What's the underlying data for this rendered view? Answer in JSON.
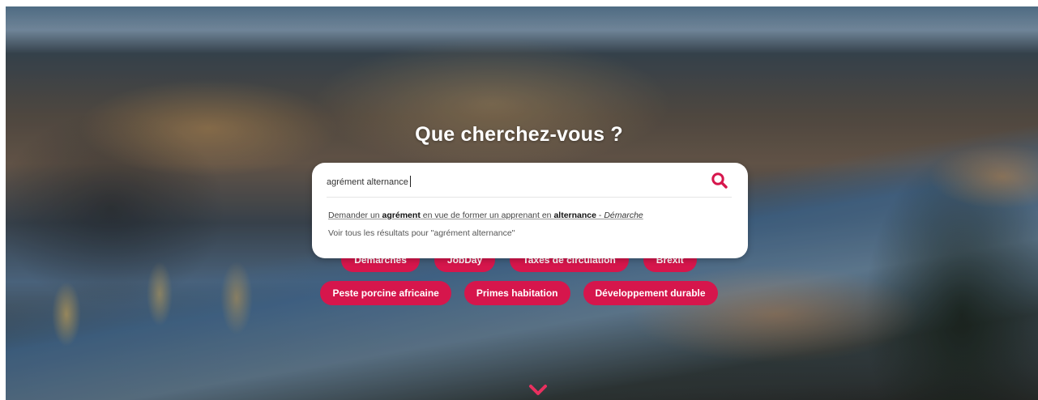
{
  "hero": {
    "title": "Que cherchez-vous ?"
  },
  "search": {
    "value": "agrément alternance",
    "suggestion": {
      "part1": "Demander un ",
      "bold1": "agrément",
      "part2": " en vue de former un apprenant en ",
      "bold2": "alternance",
      "part3": " - ",
      "type": "Démarche"
    },
    "see_all": "Voir tous les résultats pour \"agrément alternance\""
  },
  "tags_row1": [
    {
      "label": "Démarches"
    },
    {
      "label": "JobDay"
    },
    {
      "label": "Taxes de circulation"
    },
    {
      "label": "Brexit"
    }
  ],
  "tags_row2": [
    {
      "label": "Peste porcine africaine"
    },
    {
      "label": "Primes habitation"
    },
    {
      "label": "Développement durable"
    }
  ],
  "colors": {
    "accent": "#d6164c",
    "search_icon": "#d6164c",
    "panel": "#ffffff"
  },
  "icons": {
    "search": "search-icon",
    "scroll": "chevron-down-icon"
  }
}
